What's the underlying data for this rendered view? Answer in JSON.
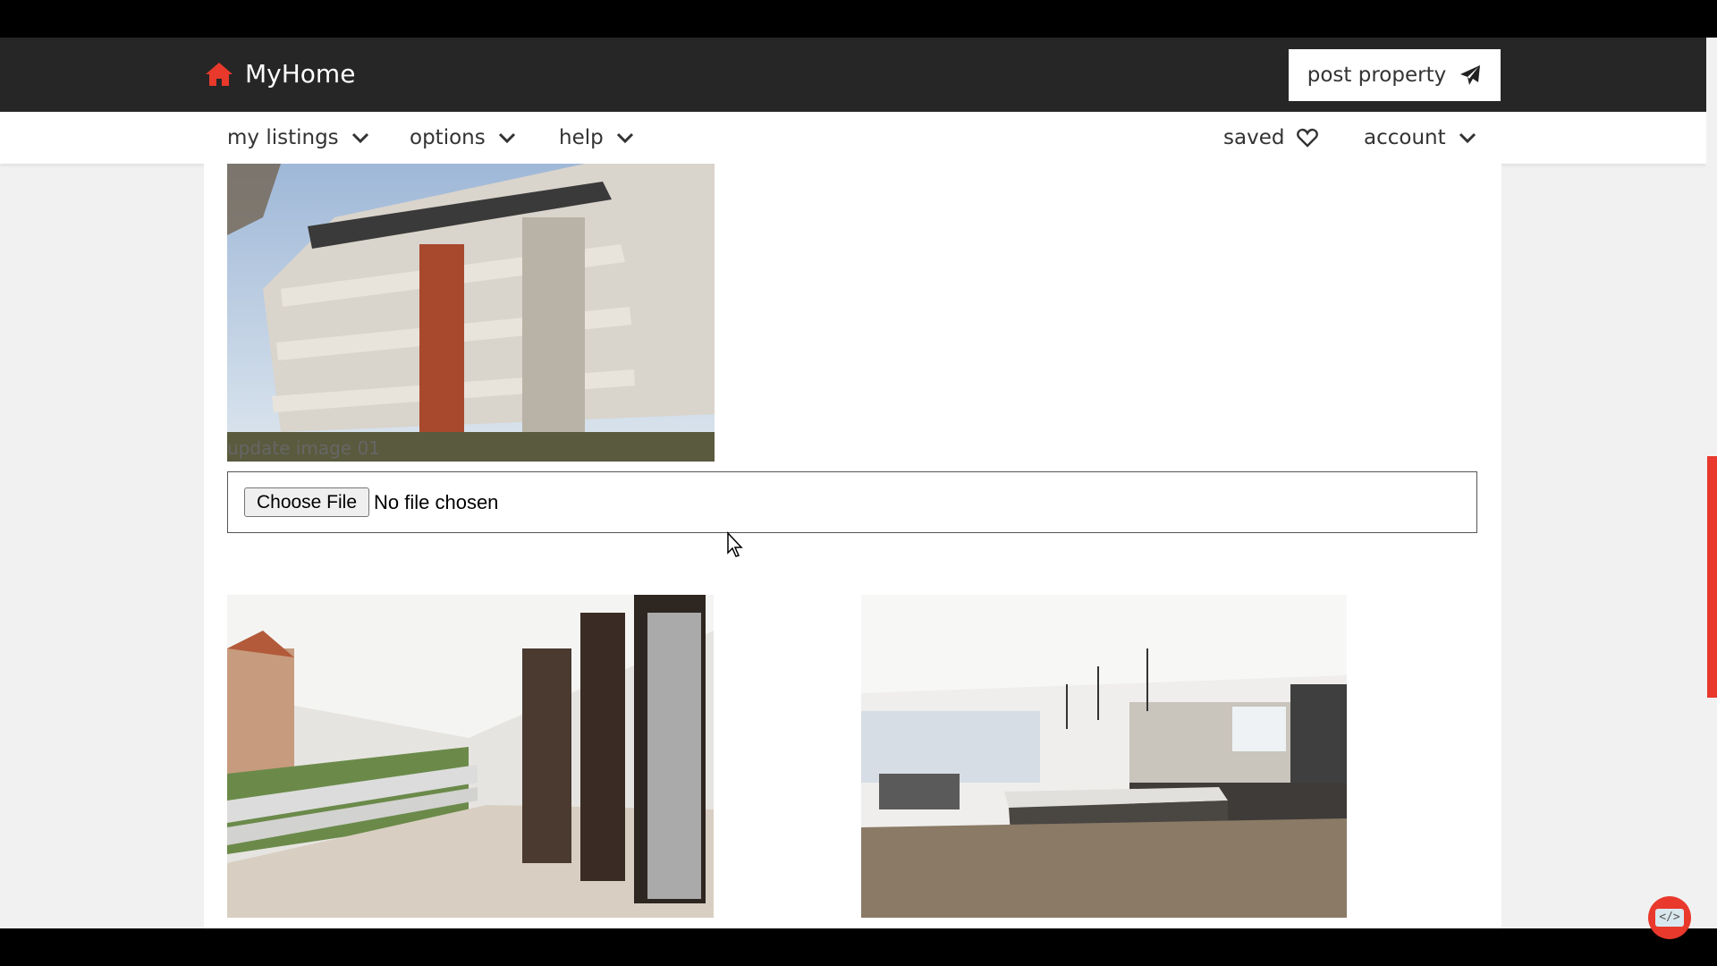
{
  "header": {
    "logo_text": "MyHome",
    "logo_icon": "house-icon",
    "post_property_label": "post property",
    "post_property_icon": "paper-plane-icon",
    "brand_color": "#e8392c",
    "bar_color": "#262626"
  },
  "nav": {
    "left_items": [
      {
        "label": "my listings",
        "icon": "chevron-down-icon"
      },
      {
        "label": "options",
        "icon": "chevron-down-icon"
      },
      {
        "label": "help",
        "icon": "chevron-down-icon"
      }
    ],
    "saved_label": "saved",
    "saved_icon": "heart-icon",
    "account_label": "account",
    "account_icon": "chevron-down-icon"
  },
  "main": {
    "image_01_alt": "modern apartment building",
    "update_label": "update image 01",
    "file_input": {
      "button_label": "Choose File",
      "status": "No file chosen"
    },
    "image_02_alt": "balcony view",
    "image_03_alt": "kitchen interior"
  },
  "floating": {
    "code_button_icon": "code-icon",
    "code_button_text": "</>"
  }
}
